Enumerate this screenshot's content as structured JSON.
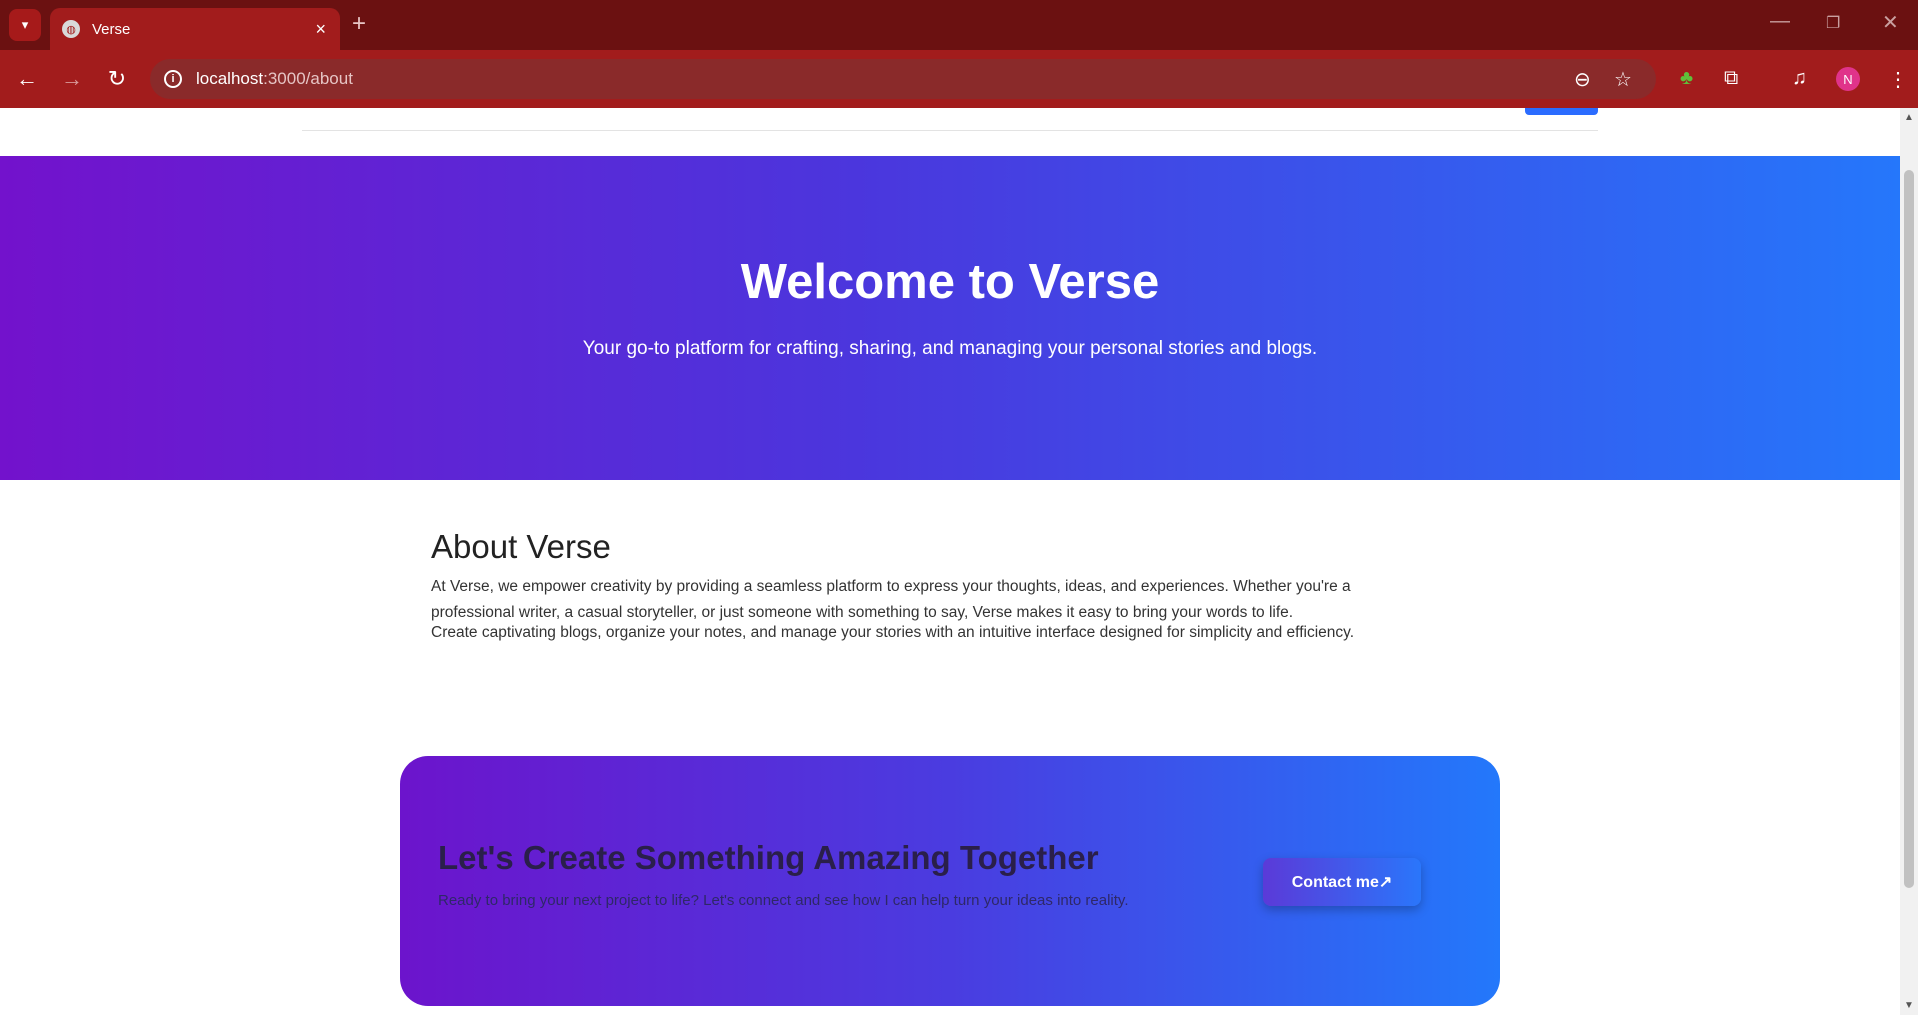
{
  "browser": {
    "tab_title": "Verse",
    "url_host": "localhost",
    "url_path": ":3000/about",
    "profile_initial": "N",
    "icons": {
      "tab_search": "chevron-down-icon",
      "favicon": "globe-icon",
      "back": "back-arrow-icon",
      "forward": "forward-arrow-icon",
      "reload": "reload-icon",
      "zoom": "zoom-out-icon",
      "bookmark": "star-icon",
      "extension": "tree-extension-icon",
      "extensions_menu": "puzzle-icon",
      "media": "media-controls-icon",
      "menu": "kebab-menu-icon"
    }
  },
  "hero": {
    "title": "Welcome to Verse",
    "subtitle": "Your go-to platform for crafting, sharing, and managing your personal stories and blogs."
  },
  "about": {
    "heading": "About Verse",
    "paragraph1": "At Verse, we empower creativity by providing a seamless platform to express your thoughts, ideas, and experiences. Whether you're a professional writer, a casual storyteller, or just someone with something to say, Verse makes it easy to bring your words to life.",
    "paragraph2": "Create captivating blogs, organize your notes, and manage your stories with an intuitive interface designed for simplicity and efficiency."
  },
  "cta": {
    "heading": "Let's Create Something Amazing Together",
    "subtext": "Ready to bring your next project to life? Let's connect and see how I can help turn your ideas into reality.",
    "button_label": "Contact me↗"
  },
  "colors": {
    "chrome_dark": "#6b1111",
    "chrome": "#a21c1c",
    "gradient_start": "#7312cc",
    "gradient_end": "#2577fb"
  }
}
